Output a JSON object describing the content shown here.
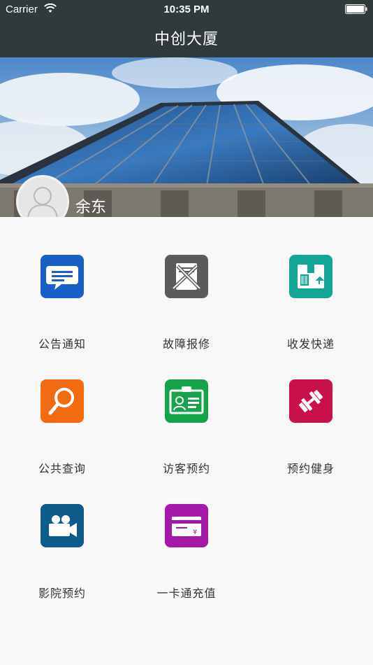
{
  "status_bar": {
    "carrier": "Carrier",
    "time": "10:35 PM"
  },
  "nav": {
    "title": "中创大厦"
  },
  "profile": {
    "name": "余东"
  },
  "services": [
    {
      "label": "公告通知",
      "icon": "message-icon",
      "color": "#1a5fc6"
    },
    {
      "label": "故障报修",
      "icon": "repair-tools-icon",
      "color": "#5b5b5b"
    },
    {
      "label": "收发快递",
      "icon": "package-icon",
      "color": "#15a596"
    },
    {
      "label": "公共查询",
      "icon": "search-icon",
      "color": "#f26b10"
    },
    {
      "label": "访客预约",
      "icon": "visitor-badge-icon",
      "color": "#16a34a"
    },
    {
      "label": "预约健身",
      "icon": "dumbbell-icon",
      "color": "#c8104a"
    },
    {
      "label": "影院预约",
      "icon": "video-camera-icon",
      "color": "#0f5b8a"
    },
    {
      "label": "一卡通充值",
      "icon": "card-icon",
      "color": "#a31aa8"
    }
  ]
}
